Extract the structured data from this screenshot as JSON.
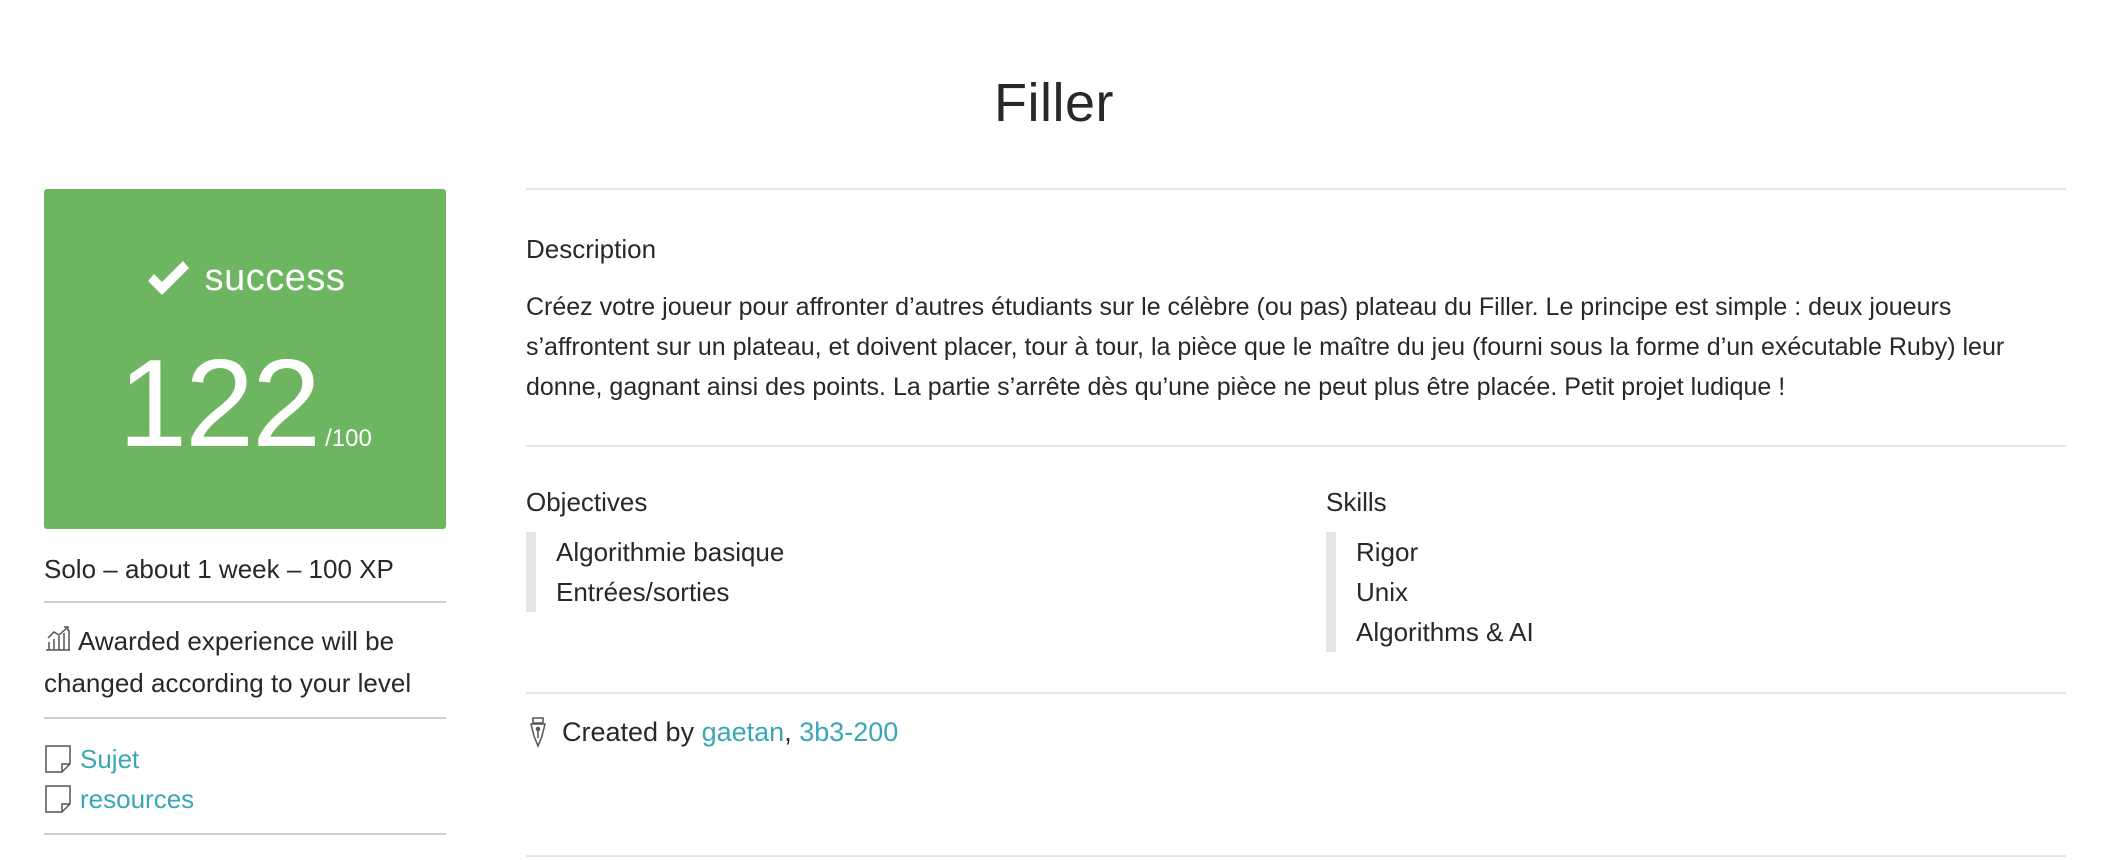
{
  "page": {
    "title": "Filler"
  },
  "colors": {
    "success": "#6eb562",
    "link": "#3aa7b5",
    "text": "#26282a"
  },
  "score": {
    "status": "success",
    "value": "122",
    "max": "/100",
    "icon": "check-icon"
  },
  "meta": {
    "text": "Solo – about 1 week – 100 XP"
  },
  "xp_note": {
    "text": "Awarded experience will be changed according to your level",
    "icon": "chart-icon"
  },
  "links": [
    {
      "label": "Sujet",
      "icon": "document-icon"
    },
    {
      "label": "resources",
      "icon": "document-icon"
    }
  ],
  "description": {
    "label": "Description",
    "text": "Créez votre joueur pour affronter d’autres étudiants sur le célèbre (ou pas) plateau du Filler. Le principe est simple : deux joueurs s’affrontent sur un plateau, et doivent placer, tour à tour, la pièce que le maître du jeu (fourni sous la forme d’un exécutable Ruby) leur donne, gagnant ainsi des points. La partie s’arrête dès qu’une pièce ne peut plus être placée. Petit projet ludique !"
  },
  "objectives": {
    "label": "Objectives",
    "items": [
      "Algorithmie basique",
      "Entrées/sorties"
    ]
  },
  "skills": {
    "label": "Skills",
    "items": [
      "Rigor",
      "Unix",
      "Algorithms & AI"
    ]
  },
  "created": {
    "prefix": "Created by",
    "authors": [
      "gaetan",
      "3b3-200"
    ],
    "separator": ",",
    "icon": "pen-icon"
  }
}
